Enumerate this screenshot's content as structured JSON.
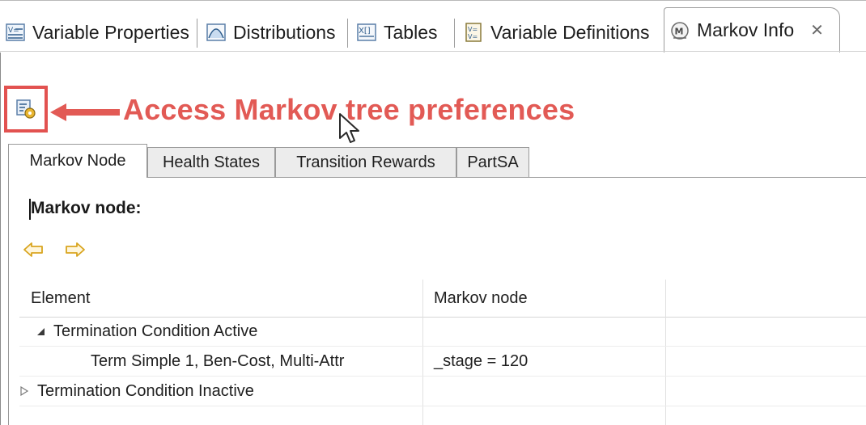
{
  "tabs": [
    {
      "label": "Variable Properties",
      "icon": "variable-properties-icon"
    },
    {
      "label": "Distributions",
      "icon": "distributions-icon"
    },
    {
      "label": "Tables",
      "icon": "tables-icon"
    },
    {
      "label": "Variable Definitions",
      "icon": "variable-definitions-icon"
    },
    {
      "label": "Markov Info",
      "icon": "markov-info-icon",
      "active": true
    }
  ],
  "close_glyph": "✕",
  "annotation": "Access Markov tree preferences",
  "annotation_color": "#e25a55",
  "inner_tabs": [
    {
      "label": "Markov Node",
      "active": true
    },
    {
      "label": "Health States"
    },
    {
      "label": "Transition Rewards"
    },
    {
      "label": "PartSA"
    }
  ],
  "node_label": "Markov node:",
  "table": {
    "headers": [
      "Element",
      "Markov node"
    ],
    "rows": [
      {
        "element": "Termination Condition Active",
        "value": "",
        "expanded": true,
        "level": 0
      },
      {
        "element": "Term Simple 1, Ben-Cost, Multi-Attr",
        "value": "_stage = 120",
        "level": 1
      },
      {
        "element": "Termination Condition Inactive",
        "value": "",
        "expanded": false,
        "level": 0
      }
    ]
  },
  "colors": {
    "highlight": "#e25250",
    "nav_arrow": "#e8b530"
  }
}
